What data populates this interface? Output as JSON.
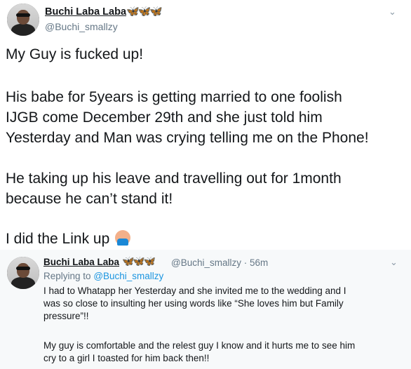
{
  "main": {
    "name": "Buchi Laba Laba",
    "butterflies": "🦋🦋🦋",
    "handle": "@Buchi_smallzy",
    "lines": [
      "My Guy is fucked up!",
      "His babe for 5years is getting married to one foolish",
      "IJGB come December 29th and she just told him",
      "Yesterday and Man was crying telling me on the Phone!",
      "He taking up his leave and travelling out for 1month",
      "because he can’t stand it!",
      "I did the Link up"
    ],
    "emoji": "facepalm-emoji"
  },
  "reply": {
    "name": "Buchi Laba Laba",
    "butterflies": "🦋🦋🦋",
    "meta": "@Buchi_smallzy · 56m",
    "replying_prefix": "Replying to",
    "replying_handle": "@Buchi_smallzy",
    "lines": [
      "I had to Whatapp her Yesterday and she invited me to the wedding and I",
      "was so close to insulting her using words like “She loves him but Family",
      "pressure”!!",
      "My guy is comfortable and the relest guy I know and it hurts me to see him",
      "cry to a girl I toasted for him back then!!"
    ]
  },
  "icons": {
    "chevron": "⌄"
  }
}
